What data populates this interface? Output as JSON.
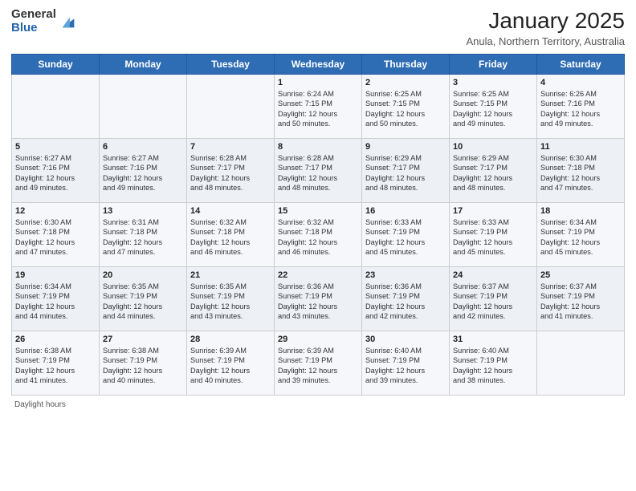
{
  "logo": {
    "general": "General",
    "blue": "Blue"
  },
  "header": {
    "title": "January 2025",
    "subtitle": "Anula, Northern Territory, Australia"
  },
  "weekdays": [
    "Sunday",
    "Monday",
    "Tuesday",
    "Wednesday",
    "Thursday",
    "Friday",
    "Saturday"
  ],
  "weeks": [
    [
      {
        "day": "",
        "info": ""
      },
      {
        "day": "",
        "info": ""
      },
      {
        "day": "",
        "info": ""
      },
      {
        "day": "1",
        "info": "Sunrise: 6:24 AM\nSunset: 7:15 PM\nDaylight: 12 hours\nand 50 minutes."
      },
      {
        "day": "2",
        "info": "Sunrise: 6:25 AM\nSunset: 7:15 PM\nDaylight: 12 hours\nand 50 minutes."
      },
      {
        "day": "3",
        "info": "Sunrise: 6:25 AM\nSunset: 7:15 PM\nDaylight: 12 hours\nand 49 minutes."
      },
      {
        "day": "4",
        "info": "Sunrise: 6:26 AM\nSunset: 7:16 PM\nDaylight: 12 hours\nand 49 minutes."
      }
    ],
    [
      {
        "day": "5",
        "info": "Sunrise: 6:27 AM\nSunset: 7:16 PM\nDaylight: 12 hours\nand 49 minutes."
      },
      {
        "day": "6",
        "info": "Sunrise: 6:27 AM\nSunset: 7:16 PM\nDaylight: 12 hours\nand 49 minutes."
      },
      {
        "day": "7",
        "info": "Sunrise: 6:28 AM\nSunset: 7:17 PM\nDaylight: 12 hours\nand 48 minutes."
      },
      {
        "day": "8",
        "info": "Sunrise: 6:28 AM\nSunset: 7:17 PM\nDaylight: 12 hours\nand 48 minutes."
      },
      {
        "day": "9",
        "info": "Sunrise: 6:29 AM\nSunset: 7:17 PM\nDaylight: 12 hours\nand 48 minutes."
      },
      {
        "day": "10",
        "info": "Sunrise: 6:29 AM\nSunset: 7:17 PM\nDaylight: 12 hours\nand 48 minutes."
      },
      {
        "day": "11",
        "info": "Sunrise: 6:30 AM\nSunset: 7:18 PM\nDaylight: 12 hours\nand 47 minutes."
      }
    ],
    [
      {
        "day": "12",
        "info": "Sunrise: 6:30 AM\nSunset: 7:18 PM\nDaylight: 12 hours\nand 47 minutes."
      },
      {
        "day": "13",
        "info": "Sunrise: 6:31 AM\nSunset: 7:18 PM\nDaylight: 12 hours\nand 47 minutes."
      },
      {
        "day": "14",
        "info": "Sunrise: 6:32 AM\nSunset: 7:18 PM\nDaylight: 12 hours\nand 46 minutes."
      },
      {
        "day": "15",
        "info": "Sunrise: 6:32 AM\nSunset: 7:18 PM\nDaylight: 12 hours\nand 46 minutes."
      },
      {
        "day": "16",
        "info": "Sunrise: 6:33 AM\nSunset: 7:19 PM\nDaylight: 12 hours\nand 45 minutes."
      },
      {
        "day": "17",
        "info": "Sunrise: 6:33 AM\nSunset: 7:19 PM\nDaylight: 12 hours\nand 45 minutes."
      },
      {
        "day": "18",
        "info": "Sunrise: 6:34 AM\nSunset: 7:19 PM\nDaylight: 12 hours\nand 45 minutes."
      }
    ],
    [
      {
        "day": "19",
        "info": "Sunrise: 6:34 AM\nSunset: 7:19 PM\nDaylight: 12 hours\nand 44 minutes."
      },
      {
        "day": "20",
        "info": "Sunrise: 6:35 AM\nSunset: 7:19 PM\nDaylight: 12 hours\nand 44 minutes."
      },
      {
        "day": "21",
        "info": "Sunrise: 6:35 AM\nSunset: 7:19 PM\nDaylight: 12 hours\nand 43 minutes."
      },
      {
        "day": "22",
        "info": "Sunrise: 6:36 AM\nSunset: 7:19 PM\nDaylight: 12 hours\nand 43 minutes."
      },
      {
        "day": "23",
        "info": "Sunrise: 6:36 AM\nSunset: 7:19 PM\nDaylight: 12 hours\nand 42 minutes."
      },
      {
        "day": "24",
        "info": "Sunrise: 6:37 AM\nSunset: 7:19 PM\nDaylight: 12 hours\nand 42 minutes."
      },
      {
        "day": "25",
        "info": "Sunrise: 6:37 AM\nSunset: 7:19 PM\nDaylight: 12 hours\nand 41 minutes."
      }
    ],
    [
      {
        "day": "26",
        "info": "Sunrise: 6:38 AM\nSunset: 7:19 PM\nDaylight: 12 hours\nand 41 minutes."
      },
      {
        "day": "27",
        "info": "Sunrise: 6:38 AM\nSunset: 7:19 PM\nDaylight: 12 hours\nand 40 minutes."
      },
      {
        "day": "28",
        "info": "Sunrise: 6:39 AM\nSunset: 7:19 PM\nDaylight: 12 hours\nand 40 minutes."
      },
      {
        "day": "29",
        "info": "Sunrise: 6:39 AM\nSunset: 7:19 PM\nDaylight: 12 hours\nand 39 minutes."
      },
      {
        "day": "30",
        "info": "Sunrise: 6:40 AM\nSunset: 7:19 PM\nDaylight: 12 hours\nand 39 minutes."
      },
      {
        "day": "31",
        "info": "Sunrise: 6:40 AM\nSunset: 7:19 PM\nDaylight: 12 hours\nand 38 minutes."
      },
      {
        "day": "",
        "info": ""
      }
    ]
  ],
  "footer": {
    "daylight_label": "Daylight hours"
  }
}
